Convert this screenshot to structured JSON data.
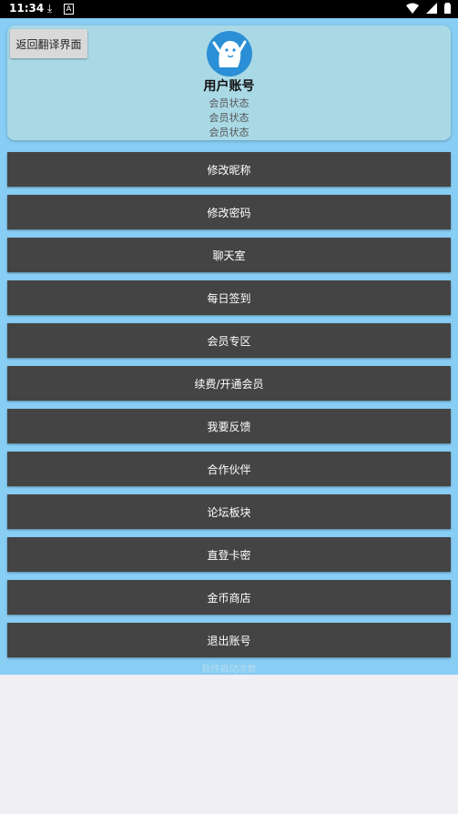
{
  "status_bar": {
    "time": "11:34"
  },
  "header": {
    "back_label": "返回翻译界面",
    "username": "用户账号",
    "member_status": [
      "会员状态",
      "会员状态",
      "会员状态"
    ]
  },
  "menu": {
    "items": [
      {
        "label": "修改昵称"
      },
      {
        "label": "修改密码"
      },
      {
        "label": "聊天室"
      },
      {
        "label": "每日签到"
      },
      {
        "label": "会员专区"
      },
      {
        "label": "续费/开通会员"
      },
      {
        "label": "我要反馈"
      },
      {
        "label": "合作伙伴"
      },
      {
        "label": "论坛板块"
      },
      {
        "label": "直登卡密"
      },
      {
        "label": "金币商店"
      },
      {
        "label": "退出账号"
      }
    ]
  },
  "footer": {
    "text": "软件启动次数"
  },
  "colors": {
    "page_bg": "#87cdf4",
    "card_bg": "#aad9e6",
    "button_bg": "#444444",
    "avatar_blue": "#2a8fd6"
  }
}
